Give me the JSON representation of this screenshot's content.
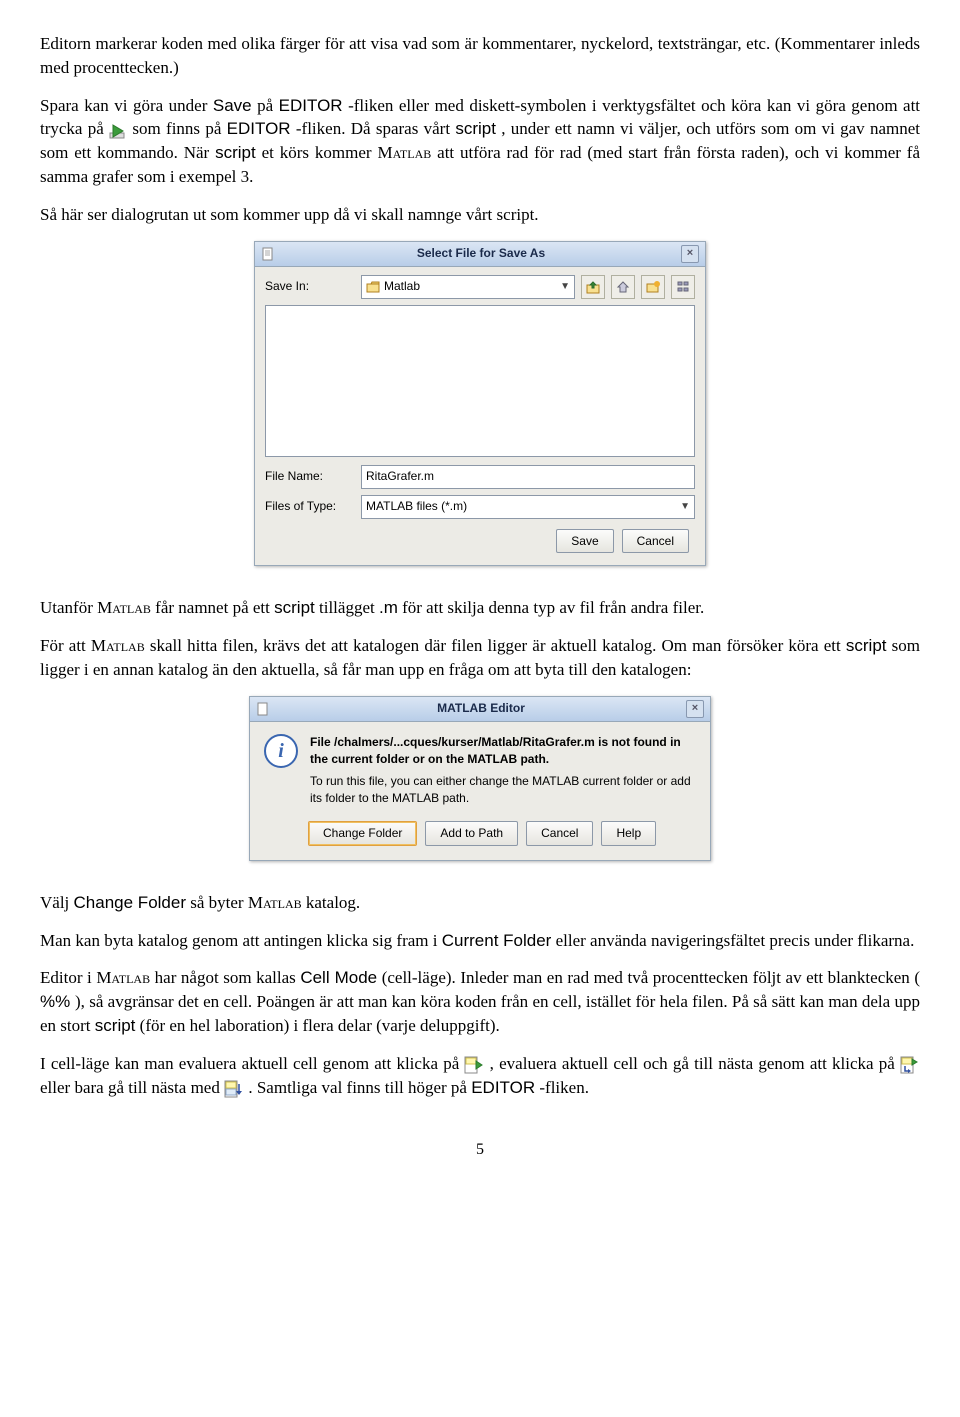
{
  "para1": "Editorn markerar koden med olika färger för att visa vad som är kommentarer, nyckelord, textsträngar, etc. (Kommentarer inleds med procenttecken.)",
  "para2a": "Spara kan vi göra under ",
  "para2b": " på ",
  "para2c": "-fliken eller med diskett-symbolen i verktygsfältet och köra kan vi göra genom att trycka på ",
  "para2d": " som finns på ",
  "para2e": "-fliken. Då sparas vårt ",
  "para2f": ", under ett namn vi väljer, och utförs som om vi gav namnet som ett kommando. När ",
  "para2g": "et körs kommer ",
  "para2h": " att utföra rad för rad (med start från första raden), och vi kommer få samma grafer som i exempel 3.",
  "sans": {
    "save": "Save",
    "editor": "EDITOR",
    "script": "script",
    "matlab": "Matlab",
    "mext": ".m",
    "change_folder": "Change Folder",
    "current_folder": "Current Folder",
    "cell_mode": "Cell Mode",
    "percent": "%% "
  },
  "para3": "Så här ser dialogrutan ut som kommer upp då vi skall namnge vårt script.",
  "dlg1": {
    "title": "Select File for Save As",
    "save_in_lbl": "Save In:",
    "save_in_val": "Matlab",
    "file_name_lbl": "File Name:",
    "file_name_val": "RitaGrafer.m",
    "file_type_lbl": "Files of Type:",
    "file_type_val": "MATLAB files (*.m)",
    "save_btn": "Save",
    "cancel_btn": "Cancel"
  },
  "para4a": "Utanför ",
  "para4b": " får namnet på ett ",
  "para4c": " tillägget ",
  "para4d": " för att skilja denna typ av fil från andra filer.",
  "para5a": "För att ",
  "para5b": " skall hitta filen, krävs det att katalogen där filen ligger är aktuell katalog. Om man försöker köra ett ",
  "para5c": " som ligger i en annan katalog än den aktuella, så får man upp en fråga om att byta till den katalogen:",
  "dlg2": {
    "title": "MATLAB Editor",
    "msg_bold": "File /chalmers/...cques/kurser/Matlab/RitaGrafer.m is not found in the current folder or on the MATLAB path.",
    "msg_plain": "To run this file, you can either change the MATLAB current folder or add its folder to the MATLAB path.",
    "btn_change": "Change Folder",
    "btn_add": "Add to Path",
    "btn_cancel": "Cancel",
    "btn_help": "Help"
  },
  "para6a": "Välj ",
  "para6b": " så byter ",
  "para6c": " katalog.",
  "para7a": "Man kan byta katalog genom att antingen klicka sig fram i ",
  "para7b": " eller använda navigeringsfältet precis under flikarna.",
  "para8a": "Editor i ",
  "para8b": " har något som kallas ",
  "para8c": " (cell-läge). Inleder man en rad med två procenttecken följt av ett blanktecken (",
  "para8d": "), så avgränsar det en cell. Poängen är att man kan köra koden från en cell, istället för hela filen. På så sätt kan man dela upp en stort ",
  "para8e": " (för en hel laboration) i flera delar (varje deluppgift).",
  "para9a": "I cell-läge kan man evaluera aktuell cell genom att klicka på ",
  "para9b": ", evaluera aktuell cell och gå till nästa genom att klicka på ",
  "para9c": " eller bara gå till nästa med ",
  "para9d": ". Samtliga val finns till höger på ",
  "para9e": "-fliken.",
  "page_number": "5"
}
